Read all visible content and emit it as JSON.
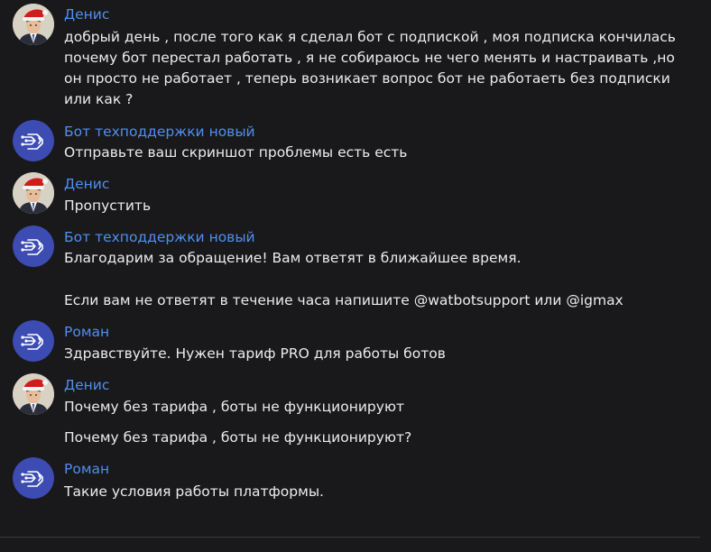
{
  "messages": [
    {
      "author": "Денис",
      "avatar": "user-avatar-denis",
      "lines": [
        "добрый день , после того как я сделал бот с подпиской , моя подписка кончилась",
        "почему бот перестал работать , я не собираюсь не чего менять и настраивать ,но",
        "он просто не работает , теперь возникает вопрос бот не работаеть без подписки",
        "или как ?"
      ]
    },
    {
      "author": "Бот техподдержки новый",
      "avatar": "bot-avatar",
      "lines": [
        "Отправьте ваш скриншот проблемы есть есть"
      ]
    },
    {
      "author": "Денис",
      "avatar": "user-avatar-denis",
      "lines": [
        "Пропустить"
      ]
    },
    {
      "author": "Бот техподдержки новый",
      "avatar": "bot-avatar",
      "lines": [
        "Благодарим за обращение! Вам ответят в ближайшее время.",
        "Если вам не ответят в течение часа напишите @watbotsupport или @igmax"
      ]
    },
    {
      "author": "Роман",
      "avatar": "bot-avatar",
      "lines": [
        "Здравствуйте. Нужен тариф PRO для работы ботов"
      ]
    },
    {
      "author": "Денис",
      "avatar": "user-avatar-denis",
      "lines": [
        "Почему без тарифа , боты не функционируют",
        "Почему без тарифа , боты не функционируют?"
      ]
    },
    {
      "author": "Роман",
      "avatar": "bot-avatar",
      "lines": [
        "Такие условия работы платформы."
      ]
    }
  ],
  "colors": {
    "background": "#19191b",
    "author": "#4f8ff0",
    "text": "#ececec",
    "bot_avatar": "#3d4cb3"
  }
}
